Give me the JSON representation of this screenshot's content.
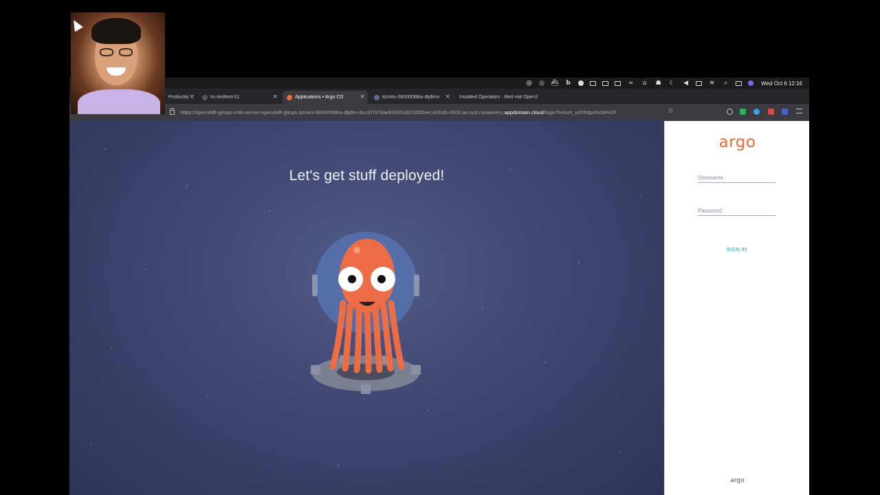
{
  "menubar": {
    "clock": "Wed Oct 6  12:16",
    "icons": [
      "at-icon",
      "record-icon",
      "docker-icon",
      "bold-b-icon",
      "circle-icon",
      "grid-icon",
      "clipboard-icon",
      "screens-icon",
      "mask-icon",
      "shield-icon",
      "users-icon",
      "moon-icon",
      "volume-icon",
      "battery-icon",
      "wifi-icon",
      "search-icon",
      "control-center-icon",
      "siri-icon"
    ]
  },
  "tabs": [
    {
      "label": "Productio",
      "active": false,
      "favicon_color": "#c0392b"
    },
    {
      "label": "hc-testfest-01",
      "active": false,
      "favicon_color": "#555555"
    },
    {
      "label": "Applications • Argo CD",
      "active": true,
      "favicon_color": "#e96d3c"
    },
    {
      "label": "itzroks-060000t8ka-dljdlmn",
      "active": false,
      "favicon_color": "#5b6b8c"
    },
    {
      "label": "Installed Operators · Red Hat OpenS",
      "active": false,
      "favicon_color": "#cc0000"
    }
  ],
  "newtab_label": "+",
  "url": {
    "prefix": "https://openshift-gitops-cntk-server-openshift-gitops.itzroks-060000t8ka-dljdlm-6ccd7f378ae819553d37d5f2ee142bd6-0000.au-syd.containers.",
    "domain": "appdomain.cloud",
    "suffix": "/login?return_url=https%3A%2F"
  },
  "hero": {
    "title": "Let's get stuff deployed!"
  },
  "login": {
    "logo": "argo",
    "username_placeholder": "Username",
    "password_placeholder": "Password",
    "signin_label": "SIGN IN",
    "footer_logo": "argo"
  },
  "colors": {
    "brand_orange": "#e96d3c",
    "signin_teal": "#1ba5a5",
    "hero_bg": "#3f4671"
  }
}
